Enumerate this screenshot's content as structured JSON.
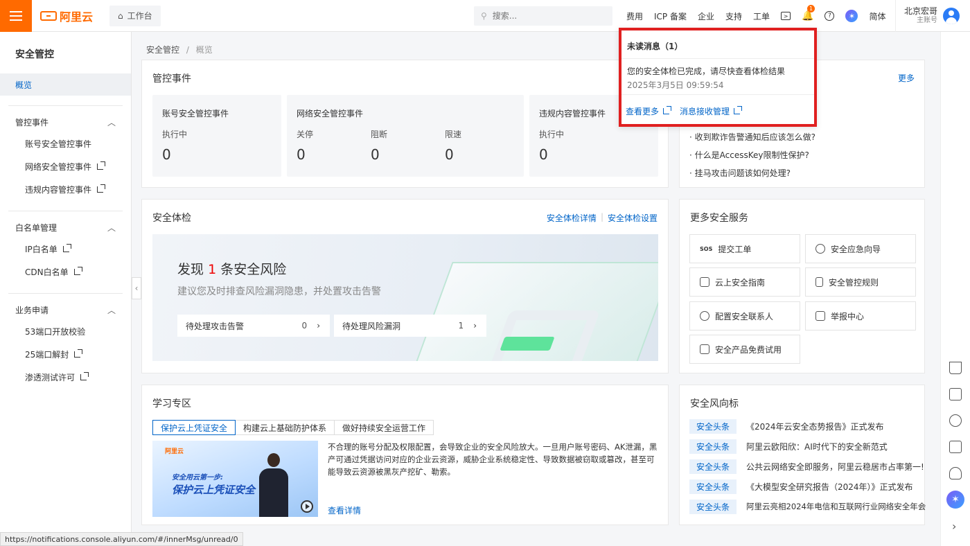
{
  "topbar": {
    "logo_text": "阿里云",
    "workbench": "工作台",
    "search_placeholder": "搜索...",
    "nav": [
      "费用",
      "ICP 备案",
      "企业",
      "支持",
      "工单"
    ],
    "bell_badge": "1",
    "lang": "简体",
    "user_name": "北京宏哥",
    "user_role": "主账号"
  },
  "sidebar": {
    "title": "安全管控",
    "active": "概览",
    "groups": [
      {
        "label": "管控事件",
        "items": [
          "账号安全管控事件",
          "网络安全管控事件",
          "违规内容管控事件"
        ]
      },
      {
        "label": "白名单管理",
        "items": [
          "IP白名单",
          "CDN白名单"
        ]
      },
      {
        "label": "业务申请",
        "items": [
          "53端口开放校验",
          "25端口解封",
          "渗透测试许可"
        ]
      }
    ]
  },
  "breadcrumb": {
    "root": "安全管控",
    "sep": "/",
    "current": "概览"
  },
  "events": {
    "title": "管控事件",
    "account": {
      "title": "账号安全管控事件",
      "label": "执行中",
      "value": "0"
    },
    "network": {
      "title": "网络安全管控事件",
      "labels": [
        "关停",
        "阻断",
        "限速"
      ],
      "values": [
        "0",
        "0",
        "0"
      ]
    },
    "content": {
      "title": "违规内容管控事件",
      "label": "执行中",
      "value": "0"
    }
  },
  "faq": {
    "more": "更多",
    "items": [
      "收到欺诈告警通知后应该怎么做?",
      "什么是AccessKey限制性保护?",
      "挂马攻击问题该如何处理?"
    ]
  },
  "checkup": {
    "title": "安全体检",
    "link_detail": "安全体检详情",
    "link_sep": "|",
    "link_settings": "安全体检设置",
    "headline_pre": "发现",
    "headline_num": "1",
    "headline_post": "条安全风险",
    "desc": "建议您及时排查风险漏洞隐患，并处置攻击告警",
    "pending_attack_label": "待处理攻击告警",
    "pending_attack_value": "0",
    "pending_vuln_label": "待处理风险漏洞",
    "pending_vuln_value": "1"
  },
  "services": {
    "title": "更多安全服务",
    "items": [
      "提交工单",
      "安全应急向导",
      "云上安全指南",
      "安全管控规则",
      "配置安全联系人",
      "举报中心",
      "安全产品免费试用"
    ]
  },
  "learning": {
    "title": "学习专区",
    "tabs": [
      "保护云上凭证安全",
      "构建云上基础防护体系",
      "做好持续安全运营工作"
    ],
    "video_logo": "阿里云",
    "video_line1": "安全用云第一步:",
    "video_line2": "保护云上凭证安全",
    "paragraph": "不合理的账号分配及权限配置，会导致企业的安全风险放大。一旦用户账号密码、AK泄漏，黑产可通过凭据访问对应的企业云资源，威胁企业系统稳定性、导致数据被窃取或篡改，甚至可能导致云资源被黑灰产挖矿、勒索。",
    "detail_link": "查看详情"
  },
  "trends": {
    "title": "安全风向标",
    "tag": "安全头条",
    "items": [
      "《2024年云安全态势报告》正式发布",
      "阿里云欧阳欣：AI时代下的安全新范式",
      "公共云网络安全即服务，阿里云稳居市占率第一!",
      "《大模型安全研究报告（2024年）》正式发布",
      "阿里云亮相2024年电信和互联网行业网络安全年会"
    ]
  },
  "popup": {
    "title": "未读消息（1）",
    "message": "您的安全体检已完成，请尽快查看体检结果",
    "date": "2025年3月5日 09:59:54",
    "view_more": "查看更多",
    "manage": "消息接收管理"
  },
  "status_url": "https://notifications.console.aliyun.com/#/innerMsg/unread/0",
  "colors": {
    "brand": "#ff6a00",
    "link": "#0064c8",
    "highlight": "#e02020"
  }
}
